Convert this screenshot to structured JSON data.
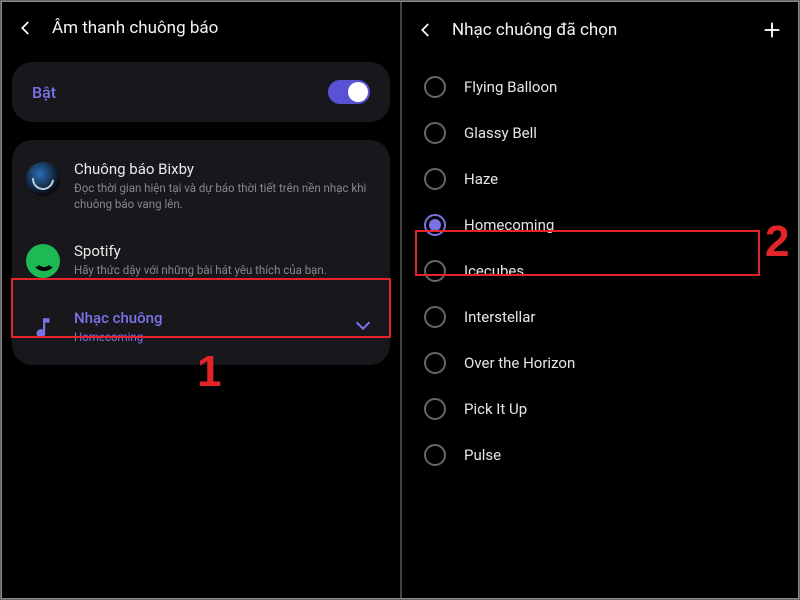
{
  "left": {
    "title": "Âm thanh chuông báo",
    "toggle_label": "Bật",
    "items": [
      {
        "title": "Chuông báo Bixby",
        "sub": "Đọc thời gian hiện tại và dự báo thời tiết trên nền nhạc khi chuông báo vang lên."
      },
      {
        "title": "Spotify",
        "sub": "Hãy thức dậy với những bài hát yêu thích của bạn."
      },
      {
        "title": "Nhạc chuông",
        "sub": "Homecoming"
      }
    ],
    "step": "1"
  },
  "right": {
    "title": "Nhạc chuông đã chọn",
    "options": [
      {
        "label": "Flying Balloon",
        "selected": false
      },
      {
        "label": "Glassy Bell",
        "selected": false
      },
      {
        "label": "Haze",
        "selected": false
      },
      {
        "label": "Homecoming",
        "selected": true
      },
      {
        "label": "Icecubes",
        "selected": false
      },
      {
        "label": "Interstellar",
        "selected": false
      },
      {
        "label": "Over the Horizon",
        "selected": false
      },
      {
        "label": "Pick It Up",
        "selected": false
      },
      {
        "label": "Pulse",
        "selected": false
      }
    ],
    "step": "2"
  }
}
